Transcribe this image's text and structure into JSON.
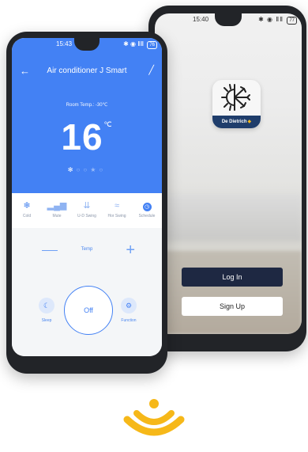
{
  "login_screen": {
    "status_time": "15:40",
    "status_icons": "✱ ◉ ⅡⅡ",
    "battery": "77",
    "brand_name": "De Dietrich",
    "login_label": "Log In",
    "signup_label": "Sign Up"
  },
  "control_screen": {
    "status_time": "15:43",
    "status_icons": "✱ ◉ ⅡⅡ",
    "battery": "76",
    "title": "Air conditioner J Smart",
    "room_temp": "Room Temp.: -30℃",
    "setpoint": "16",
    "unit": "℃",
    "modes": [
      {
        "label": "Cold",
        "icon": "snowflake-icon"
      },
      {
        "label": "Mute",
        "icon": "signal-bars-icon"
      },
      {
        "label": "U-D Swing",
        "icon": "updown-swing-icon"
      },
      {
        "label": "Hor Swing",
        "icon": "horizontal-swing-icon"
      },
      {
        "label": "Schedule",
        "icon": "clock-icon"
      }
    ],
    "temp_label": "Temp",
    "power_label": "Off",
    "sleep_label": "Sleep",
    "function_label": "Function"
  },
  "colors": {
    "accent": "#4381f4",
    "dark_button": "#1e2842",
    "brand_yellow": "#f6b819"
  }
}
